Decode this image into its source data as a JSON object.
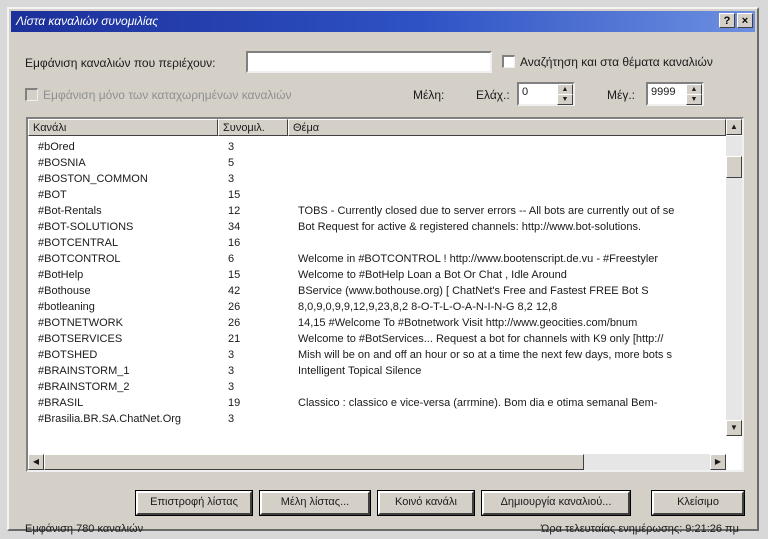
{
  "window": {
    "title": "Λίστα καναλιών συνομιλίας",
    "help_glyph": "?",
    "close_glyph": "×"
  },
  "filter": {
    "label": "Εμφάνιση καναλιών που περιέχουν:",
    "value": "",
    "topics_checkbox_label": "Αναζήτηση και στα θέματα καναλιών",
    "registered_checkbox_label": "Εμφάνιση μόνο των καταχωρημένων καναλιών",
    "members_label": "Μέλη:",
    "min_label": "Ελάχ.:",
    "min_value": "0",
    "max_label": "Μέγ.:",
    "max_value": "9999"
  },
  "table": {
    "columns": [
      "Κανάλι",
      "Συνομιλ.",
      "Θέμα"
    ],
    "rows": [
      {
        "channel": "#bOred",
        "users": "3",
        "topic": ""
      },
      {
        "channel": "#BOSNIA",
        "users": "5",
        "topic": ""
      },
      {
        "channel": "#BOSTON_COMMON",
        "users": "3",
        "topic": ""
      },
      {
        "channel": "#BOT",
        "users": "15",
        "topic": ""
      },
      {
        "channel": "#Bot-Rentals",
        "users": "12",
        "topic": "TOBS - Currently closed due to server errors -- All bots are currently out of se"
      },
      {
        "channel": "#BOT-SOLUTIONS",
        "users": "34",
        "topic": "Bot Request for active & registered channels: http://www.bot-solutions."
      },
      {
        "channel": "#BOTCENTRAL",
        "users": "16",
        "topic": ""
      },
      {
        "channel": "#BOTCONTROL",
        "users": "6",
        "topic": "Welcome in #BOTCONTROL ! http://www.bootenscript.de.vu - #Freestyler"
      },
      {
        "channel": "#BotHelp",
        "users": "15",
        "topic": "Welcome to #BotHelp Loan a Bot Or Chat , Idle Around"
      },
      {
        "channel": "#Bothouse",
        "users": "42",
        "topic": "BService (www.bothouse.org) [ ChatNet's Free and Fastest FREE Bot S"
      },
      {
        "channel": "#botleaning",
        "users": "26",
        "topic": "8,0,9,0,9,9,12,9,23,8,2 8-O-T-L-O-A-N-I-N-G 8,2 12,8"
      },
      {
        "channel": "#BOTNETWORK",
        "users": "26",
        "topic": "14,15 #Welcome To #Botnetwork Visit http://www.geocities.com/bnum"
      },
      {
        "channel": "#BOTSERVICES",
        "users": "21",
        "topic": "Welcome to #BotServices... Request a bot for channels with K9 only [http://"
      },
      {
        "channel": "#BOTSHED",
        "users": "3",
        "topic": "Mish will be on and off an hour or so at a time the next few days, more bots s"
      },
      {
        "channel": "#BRAINSTORM_1",
        "users": "3",
        "topic": "Intelligent Topical Silence"
      },
      {
        "channel": "#BRAINSTORM_2",
        "users": "3",
        "topic": ""
      },
      {
        "channel": "#BRASIL",
        "users": "19",
        "topic": "Classico : classico e vice-versa (arrmine). Bom dia e otima semanal Bem-"
      },
      {
        "channel": "#Brasilia.BR.SA.ChatNet.Org",
        "users": "3",
        "topic": ""
      }
    ]
  },
  "buttons": {
    "refresh": "Επιστροφή λίστας",
    "members_list": "Μέλη λίστας...",
    "join": "Κοινό κανάλι",
    "create": "Δημιουργία καναλιού...",
    "close": "Κλείσιμο"
  },
  "status": {
    "count": "Εμφάνιση 780 καναλιών",
    "last_update": "Ώρα τελευταίας ενημέρωσης: 9:21:26 πμ"
  }
}
